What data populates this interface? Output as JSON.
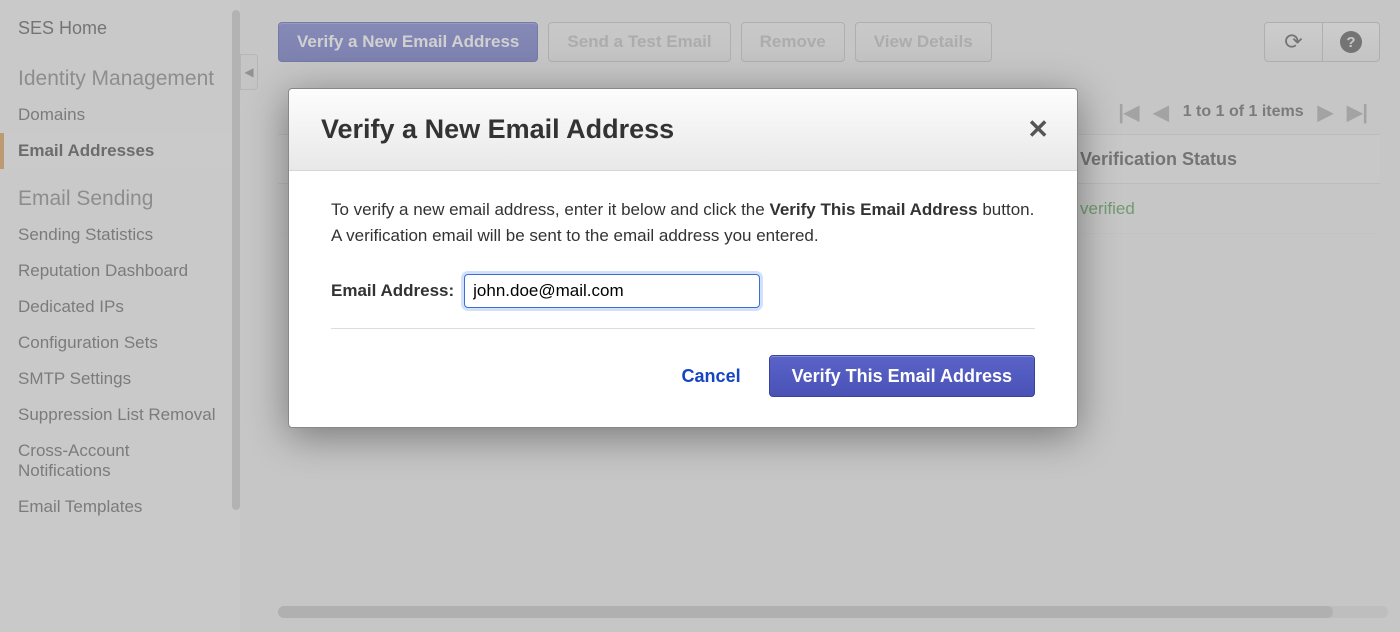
{
  "sidebar": {
    "home": "SES Home",
    "group1_header": "Identity Management",
    "group1_items": [
      "Domains",
      "Email Addresses"
    ],
    "group1_active_index": 1,
    "group2_header": "Email Sending",
    "group2_items": [
      "Sending Statistics",
      "Reputation Dashboard",
      "Dedicated IPs",
      "Configuration Sets",
      "SMTP Settings",
      "Suppression List Removal",
      "Cross-Account Notifications",
      "Email Templates"
    ]
  },
  "toolbar": {
    "verify": "Verify a New Email Address",
    "send_test": "Send a Test Email",
    "remove": "Remove",
    "view_details": "View Details"
  },
  "pager": {
    "text": "1 to 1 of 1 items"
  },
  "table": {
    "header_status": "Verification Status",
    "row0_status": "verified"
  },
  "modal": {
    "title": "Verify a New Email Address",
    "body_pre": "To verify a new email address, enter it below and click the ",
    "body_bold": "Verify This Email Address",
    "body_post": " button. A verification email will be sent to the email address you entered.",
    "field_label": "Email Address:",
    "field_value": "john.doe@mail.com",
    "cancel": "Cancel",
    "confirm": "Verify This Email Address"
  }
}
